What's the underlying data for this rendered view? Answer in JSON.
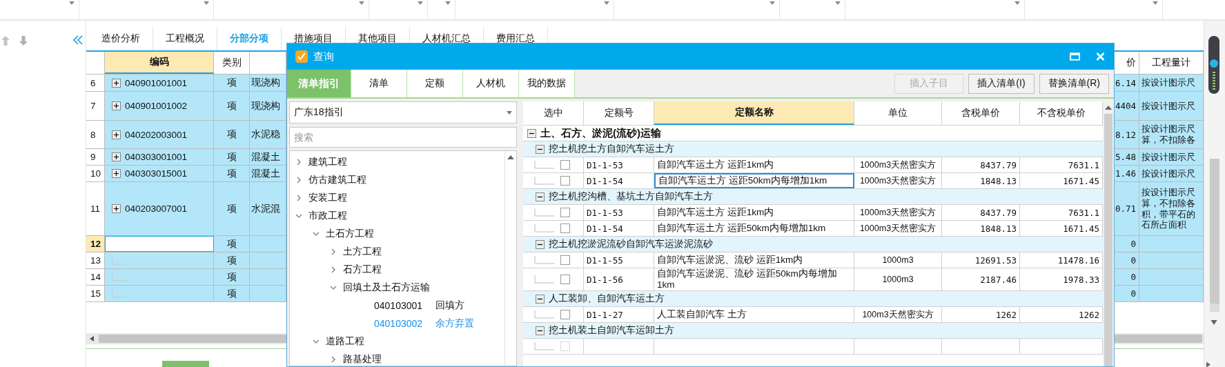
{
  "main_tabs": [
    {
      "label": "造价分析",
      "selected": false
    },
    {
      "label": "工程概况",
      "selected": false
    },
    {
      "label": "分部分项",
      "selected": true
    },
    {
      "label": "措施项目",
      "selected": false
    },
    {
      "label": "其他项目",
      "selected": false
    },
    {
      "label": "人材机汇总",
      "selected": false
    },
    {
      "label": "费用汇总",
      "selected": false
    }
  ],
  "zoom_slider": {
    "level": 0.5
  },
  "grid": {
    "columns": {
      "code": "编码",
      "type": "类别",
      "amount": "价",
      "rule": "工程量计"
    },
    "rows": [
      {
        "num": "6",
        "current": false,
        "expanded": false,
        "code": "040901001001",
        "type": "项",
        "name": "现浇构",
        "amount": "6.14",
        "rule": "按设计图示尺"
      },
      {
        "num": "7",
        "current": false,
        "expanded": false,
        "code": "040901001002",
        "type": "项",
        "name": "现浇构",
        "amount": "4404",
        "rule": "按设计图示尺"
      },
      {
        "num": "8",
        "current": false,
        "expanded": false,
        "code": "040202003001",
        "type": "项",
        "name": "水泥稳",
        "amount": "8.12",
        "rule": "按设计图示尺",
        "rule_more": [
          "算，不扣除各"
        ]
      },
      {
        "num": "9",
        "current": false,
        "expanded": false,
        "code": "040303001001",
        "type": "项",
        "name": "混凝土",
        "amount": "5.48",
        "rule": "按设计图示尺"
      },
      {
        "num": "10",
        "current": false,
        "expanded": false,
        "code": "040303015001",
        "type": "项",
        "name": "混凝土",
        "amount": "1.46",
        "rule": "按设计图示尺"
      },
      {
        "num": "11",
        "current": false,
        "expanded": false,
        "code": "040203007001",
        "type": "项",
        "name": "水泥混",
        "amount": "0.71",
        "rule": "按设计图示尺",
        "rule_more": [
          "算，不扣除各",
          "积，带平石的",
          "石所占面积"
        ]
      },
      {
        "num": "12",
        "current": true,
        "type": "项",
        "amount": "0"
      },
      {
        "num": "13",
        "current": false,
        "type": "项",
        "amount": "0"
      },
      {
        "num": "14",
        "current": false,
        "type": "项",
        "amount": "0"
      },
      {
        "num": "15",
        "current": false,
        "type": "项",
        "amount": "0"
      }
    ]
  },
  "dialog": {
    "title": "查询",
    "tabs": [
      {
        "label": "清单指引",
        "selected": true
      },
      {
        "label": "清单",
        "selected": false
      },
      {
        "label": "定额",
        "selected": false
      },
      {
        "label": "人材机",
        "selected": false
      },
      {
        "label": "我的数据",
        "selected": false
      }
    ],
    "buttons": [
      {
        "label": "插入子目",
        "disabled": true
      },
      {
        "label": "插入清单(I)",
        "disabled": false
      },
      {
        "label": "替换清单(R)",
        "disabled": false
      }
    ],
    "library": {
      "value": "广东18指引"
    },
    "search": {
      "placeholder": "搜索"
    },
    "tree": [
      {
        "label": "建筑工程",
        "expanded": false
      },
      {
        "label": "仿古建筑工程",
        "expanded": false
      },
      {
        "label": "安装工程",
        "expanded": false
      },
      {
        "label": "市政工程",
        "expanded": true,
        "children": [
          {
            "label": "土石方工程",
            "expanded": true,
            "children": [
              {
                "label": "土方工程",
                "expanded": false
              },
              {
                "label": "石方工程",
                "expanded": false
              },
              {
                "label": "回填土及土石方运输",
                "expanded": true,
                "children": [
                  {
                    "code": "040103001",
                    "label": "回填方",
                    "selected": false
                  },
                  {
                    "code": "040103002",
                    "label": "余方弃置",
                    "selected": true
                  }
                ]
              }
            ]
          },
          {
            "label": "道路工程",
            "expanded": true,
            "children": [
              {
                "label": "路基处理",
                "expanded": false
              }
            ]
          }
        ]
      }
    ],
    "quota_table": {
      "columns": {
        "pick": "选中",
        "code": "定额号",
        "name": "定额名称",
        "unit": "单位",
        "price_tax": "含税单价",
        "price_notax": "不含税单价"
      },
      "sections": [
        {
          "title": "土、石方、淤泥(流砂)运输",
          "expanded": true,
          "groups": [
            {
              "title": "挖土机挖土方自卸汽车运土方",
              "expanded": true,
              "rows": [
                {
                  "checked": false,
                  "disabled": false,
                  "focused": false,
                  "code": "D1-1-53",
                  "name": "自卸汽车运土方 运距1km内",
                  "unit": "1000m3天然密实方",
                  "price_tax": "8437.79",
                  "price_notax": "7631.1"
                },
                {
                  "checked": false,
                  "disabled": false,
                  "focused": true,
                  "code": "D1-1-54",
                  "name": "自卸汽车运土方 运距50km内每增加1km",
                  "unit": "1000m3天然密实方",
                  "price_tax": "1848.13",
                  "price_notax": "1671.45"
                }
              ]
            },
            {
              "title": "挖土机挖沟槽、基坑土方自卸汽车土方",
              "expanded": true,
              "rows": [
                {
                  "checked": false,
                  "disabled": false,
                  "focused": false,
                  "code": "D1-1-53",
                  "name": "自卸汽车运土方 运距1km内",
                  "unit": "1000m3天然密实方",
                  "price_tax": "8437.79",
                  "price_notax": "7631.1"
                },
                {
                  "checked": false,
                  "disabled": false,
                  "focused": false,
                  "code": "D1-1-54",
                  "name": "自卸汽车运土方 运距50km内每增加1km",
                  "unit": "1000m3天然密实方",
                  "price_tax": "1848.13",
                  "price_notax": "1671.45"
                }
              ]
            },
            {
              "title": "挖土机挖淤泥流砂自卸汽车运淤泥流砂",
              "expanded": true,
              "rows": [
                {
                  "checked": false,
                  "disabled": false,
                  "focused": false,
                  "code": "D1-1-55",
                  "name": "自卸汽车运淤泥、流砂 运距1km内",
                  "unit": "1000m3",
                  "price_tax": "12691.53",
                  "price_notax": "11478.16"
                },
                {
                  "checked": false,
                  "disabled": false,
                  "focused": false,
                  "code": "D1-1-56",
                  "name": "自卸汽车运淤泥、流砂 运距50km内每增加1km",
                  "unit": "1000m3",
                  "price_tax": "2187.46",
                  "price_notax": "1978.33"
                }
              ]
            },
            {
              "title": "人工装卸、自卸汽车运土方",
              "expanded": true,
              "rows": [
                {
                  "checked": false,
                  "disabled": false,
                  "focused": false,
                  "code": "D1-1-27",
                  "name": "人工装自卸汽车 土方",
                  "unit": "100m3天然密实方",
                  "price_tax": "1262",
                  "price_notax": "1262"
                }
              ]
            },
            {
              "title": "挖土机装土自卸汽车运卸土方",
              "expanded": true,
              "rows": [
                {
                  "checked": false,
                  "disabled": true,
                  "focused": false
                }
              ]
            }
          ]
        }
      ]
    }
  }
}
